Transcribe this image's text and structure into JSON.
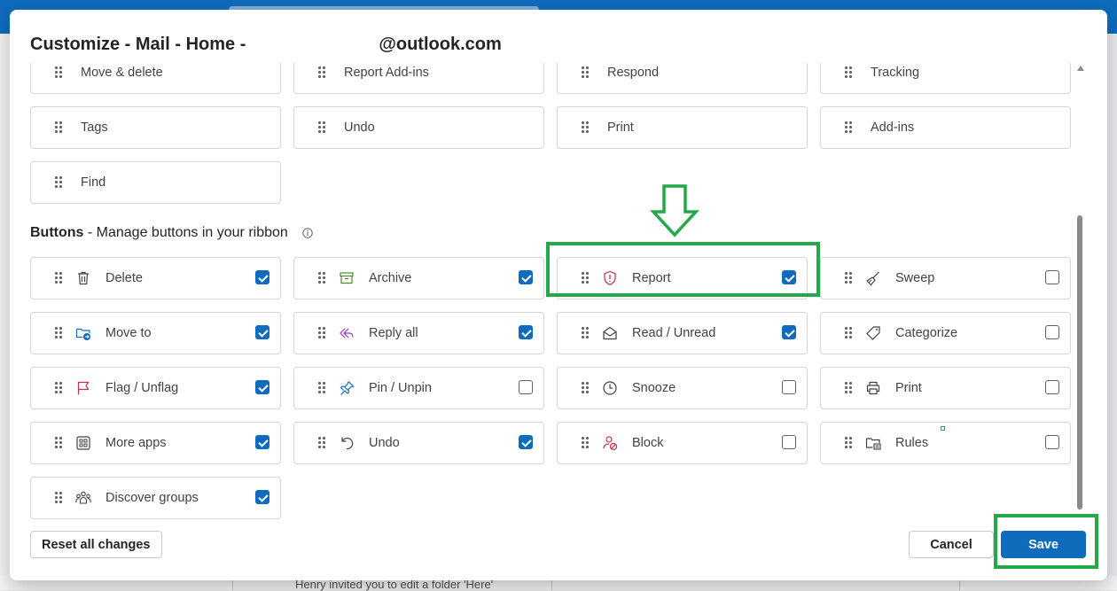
{
  "dialog": {
    "title_prefix": "Customize - Mail - Home -",
    "title_suffix": "@outlook.com"
  },
  "groups": [
    {
      "label": "Move & delete"
    },
    {
      "label": "Report Add-ins"
    },
    {
      "label": "Respond"
    },
    {
      "label": "Tracking"
    },
    {
      "label": "Tags"
    },
    {
      "label": "Undo"
    },
    {
      "label": "Print"
    },
    {
      "label": "Add-ins"
    },
    {
      "label": "Find"
    }
  ],
  "buttons_section": {
    "title": "Buttons",
    "subtitle": " - Manage buttons in your ribbon"
  },
  "buttons": [
    {
      "label": "Delete",
      "icon": "trash-icon",
      "checked": true
    },
    {
      "label": "Archive",
      "icon": "archive-icon",
      "checked": true
    },
    {
      "label": "Report",
      "icon": "shield-alert-icon",
      "checked": true
    },
    {
      "label": "Sweep",
      "icon": "broom-icon",
      "checked": false
    },
    {
      "label": "Move to",
      "icon": "folder-move-icon",
      "checked": true
    },
    {
      "label": "Reply all",
      "icon": "reply-all-icon",
      "checked": true
    },
    {
      "label": "Read / Unread",
      "icon": "envelope-open-icon",
      "checked": true
    },
    {
      "label": "Categorize",
      "icon": "tag-icon",
      "checked": false
    },
    {
      "label": "Flag / Unflag",
      "icon": "flag-icon",
      "checked": true
    },
    {
      "label": "Pin / Unpin",
      "icon": "pin-icon",
      "checked": false
    },
    {
      "label": "Snooze",
      "icon": "clock-icon",
      "checked": false
    },
    {
      "label": "Print",
      "icon": "printer-icon",
      "checked": false
    },
    {
      "label": "More apps",
      "icon": "apps-grid-icon",
      "checked": true
    },
    {
      "label": "Undo",
      "icon": "undo-icon",
      "checked": true
    },
    {
      "label": "Block",
      "icon": "block-user-icon",
      "checked": false
    },
    {
      "label": "Rules",
      "icon": "rules-folder-icon",
      "checked": false
    },
    {
      "label": "Discover groups",
      "icon": "people-group-icon",
      "checked": true
    }
  ],
  "footer": {
    "reset_label": "Reset all changes",
    "cancel_label": "Cancel",
    "save_label": "Save"
  },
  "background": {
    "notification_text": "Henry invited you to edit a folder 'Here'"
  },
  "colors": {
    "accent": "#0f6cbd",
    "annotation": "#23a84a"
  }
}
